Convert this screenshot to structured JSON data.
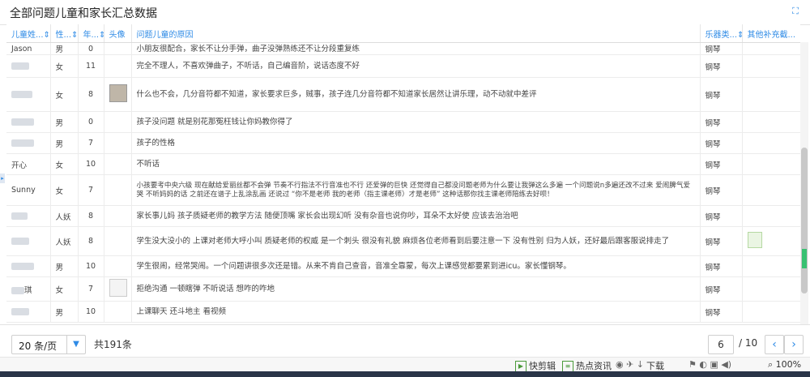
{
  "header": {
    "title": "全部问题儿童和家长汇总数据",
    "expand_icon": "expand-icon"
  },
  "table": {
    "columns": [
      "儿童姓...⇕",
      "性...⇕",
      "年...⇕",
      "头像",
      "问题儿童的原因",
      "乐器类...⇕",
      "其他补充截..."
    ],
    "rows": [
      {
        "name": "Jason",
        "gender": "男",
        "age": "0",
        "reason": "小朋友很配合，家长不让分手弹，曲子没弹熟练还不让分段重复练",
        "instrument": "钢琴"
      },
      {
        "name": "",
        "gender": "女",
        "age": "11",
        "reason": "完全不理人，不喜欢弹曲子，不听话，自己编音阶，说话态度不好",
        "instrument": "钢琴"
      },
      {
        "name": "",
        "gender": "女",
        "age": "8",
        "reason": "什么也不会，几分音符都不知道，家长要求巨多，贼事，孩子连几分音符都不知道家长居然让讲乐理，动不动就中差评",
        "instrument": "钢琴"
      },
      {
        "name": "",
        "gender": "男",
        "age": "0",
        "reason": "孩子没问题 就是别花那冤枉钱让你妈教你得了",
        "instrument": "钢琴"
      },
      {
        "name": "",
        "gender": "男",
        "age": "7",
        "reason": "孩子的性格",
        "instrument": "钢琴"
      },
      {
        "name": "开心",
        "gender": "女",
        "age": "10",
        "reason": "不听话",
        "instrument": "钢琴"
      },
      {
        "name": "Sunny",
        "gender": "女",
        "age": "7",
        "reason": "小孩要考中央六级 现在献给爱丽丝都不会弹 节奏不行指法不行音准也不行 还爱弹的巨快 还觉得自己都没问题老师为什么要让我弹这么多遍 一个问题说n多遍还改不过来 爱闹脾气爱哭 不听妈妈的话 之前还在谱子上乱涂乱画 还说过 “你不是老师 我的老师（指主课老师）才是老师” 这种话那你找主课老师陪练去好呗！",
        "instrument": "钢琴"
      },
      {
        "name": "",
        "gender": "人妖",
        "age": "8",
        "reason": "家长事儿妈 孩子质疑老师的教学方法 随便顶嘴 家长会出现幻听 没有杂音也说你吵，耳朵不太好使 应该去治治吧",
        "instrument": "钢琴"
      },
      {
        "name": "",
        "gender": "人妖",
        "age": "8",
        "reason": "学生没大没小的 上课对老师大呼小叫 质疑老师的权威 是一个刺头 很没有礼貌 麻烦各位老师看到后要注意一下 没有性别 归为人妖，还好最后跟客服说排走了",
        "instrument": "钢琴"
      },
      {
        "name": "",
        "gender": "男",
        "age": "10",
        "reason": "学生很闹，经常哭闹。一个问题讲很多次还是错。从来不肯自己查音，音准全靠蒙，每次上课感觉都要累到进icu。家长懂钢琴。",
        "instrument": "钢琴"
      },
      {
        "name": "琪",
        "gender": "女",
        "age": "7",
        "reason": "拒绝沟通 一顿瞎弹 不听说话 想咋的咋地",
        "instrument": "钢琴"
      },
      {
        "name": "",
        "gender": "男",
        "age": "10",
        "reason": "上课聊天 还斗地主 看视频",
        "instrument": "钢琴"
      }
    ]
  },
  "pager": {
    "page_size": "20 条/页",
    "total": "共191条",
    "current_page": "6",
    "total_pages": "/ 10",
    "prev": "‹",
    "next": "›"
  },
  "statusbar": {
    "items": [
      "快剪辑",
      "热点资讯",
      "下载",
      "100%"
    ]
  }
}
